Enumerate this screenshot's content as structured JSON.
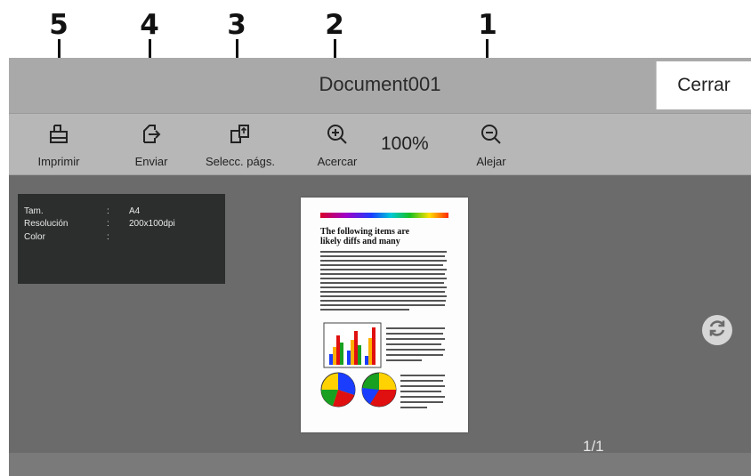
{
  "callouts": [
    "5",
    "4",
    "3",
    "2",
    "1"
  ],
  "window": {
    "title": "Document001",
    "close_label": "Cerrar"
  },
  "toolbar": {
    "print_label": "Imprimir",
    "send_label": "Enviar",
    "select_pages_label": "Selecc. págs.",
    "zoom_in_label": "Acercar",
    "zoom_level": "100%",
    "zoom_out_label": "Alejar"
  },
  "info": {
    "rows": [
      {
        "key": "Tam.",
        "sep": ":",
        "value": "A4"
      },
      {
        "key": "Resolución",
        "sep": ":",
        "value": "200x100dpi"
      },
      {
        "key": "Color",
        "sep": ":",
        "value": ""
      }
    ]
  },
  "preview": {
    "heading": "The following items are likely diffs and many",
    "page_counter": "1/1"
  },
  "icons": {
    "print": "printer-icon",
    "send": "send-icon",
    "select_pages": "select-pages-icon",
    "zoom_in": "zoom-in-icon",
    "zoom_out": "zoom-out-icon",
    "rotate": "rotate-icon"
  }
}
